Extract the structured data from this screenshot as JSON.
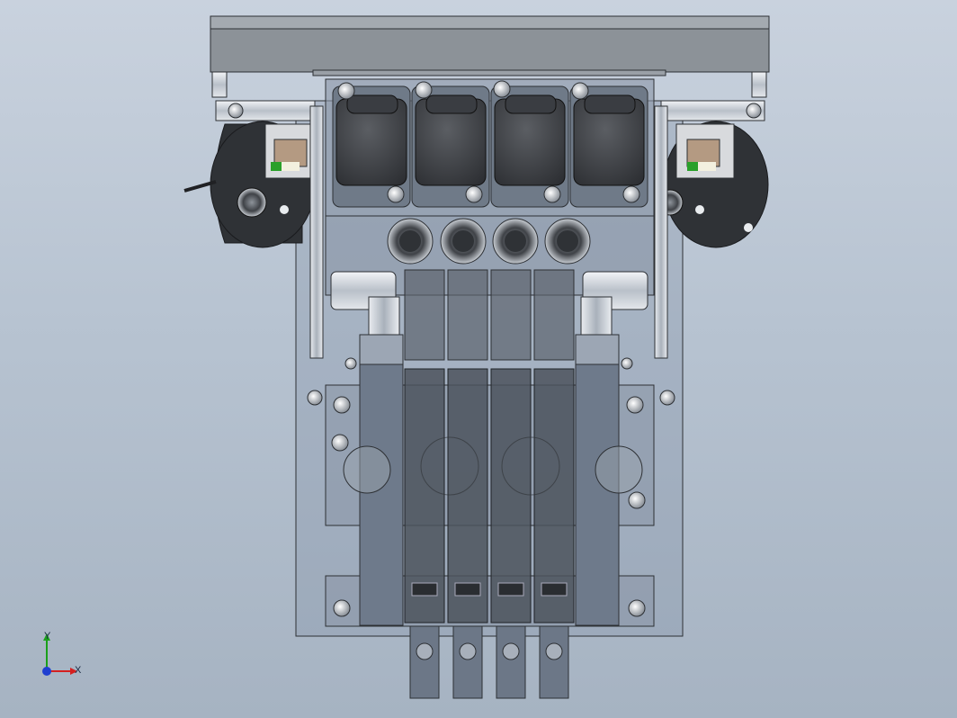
{
  "viewport": {
    "background_top": "#c9d2de",
    "background_bottom": "#a6b3c2"
  },
  "triad": {
    "x_label": "X",
    "y_label": "Y",
    "x_color": "#d42020",
    "y_color": "#1aa01a",
    "z_color": "#1f3fd0"
  },
  "model": {
    "body_color": "#7f8b9a",
    "dark_color": "#3a3d42",
    "metal_color": "#d9dde3"
  }
}
